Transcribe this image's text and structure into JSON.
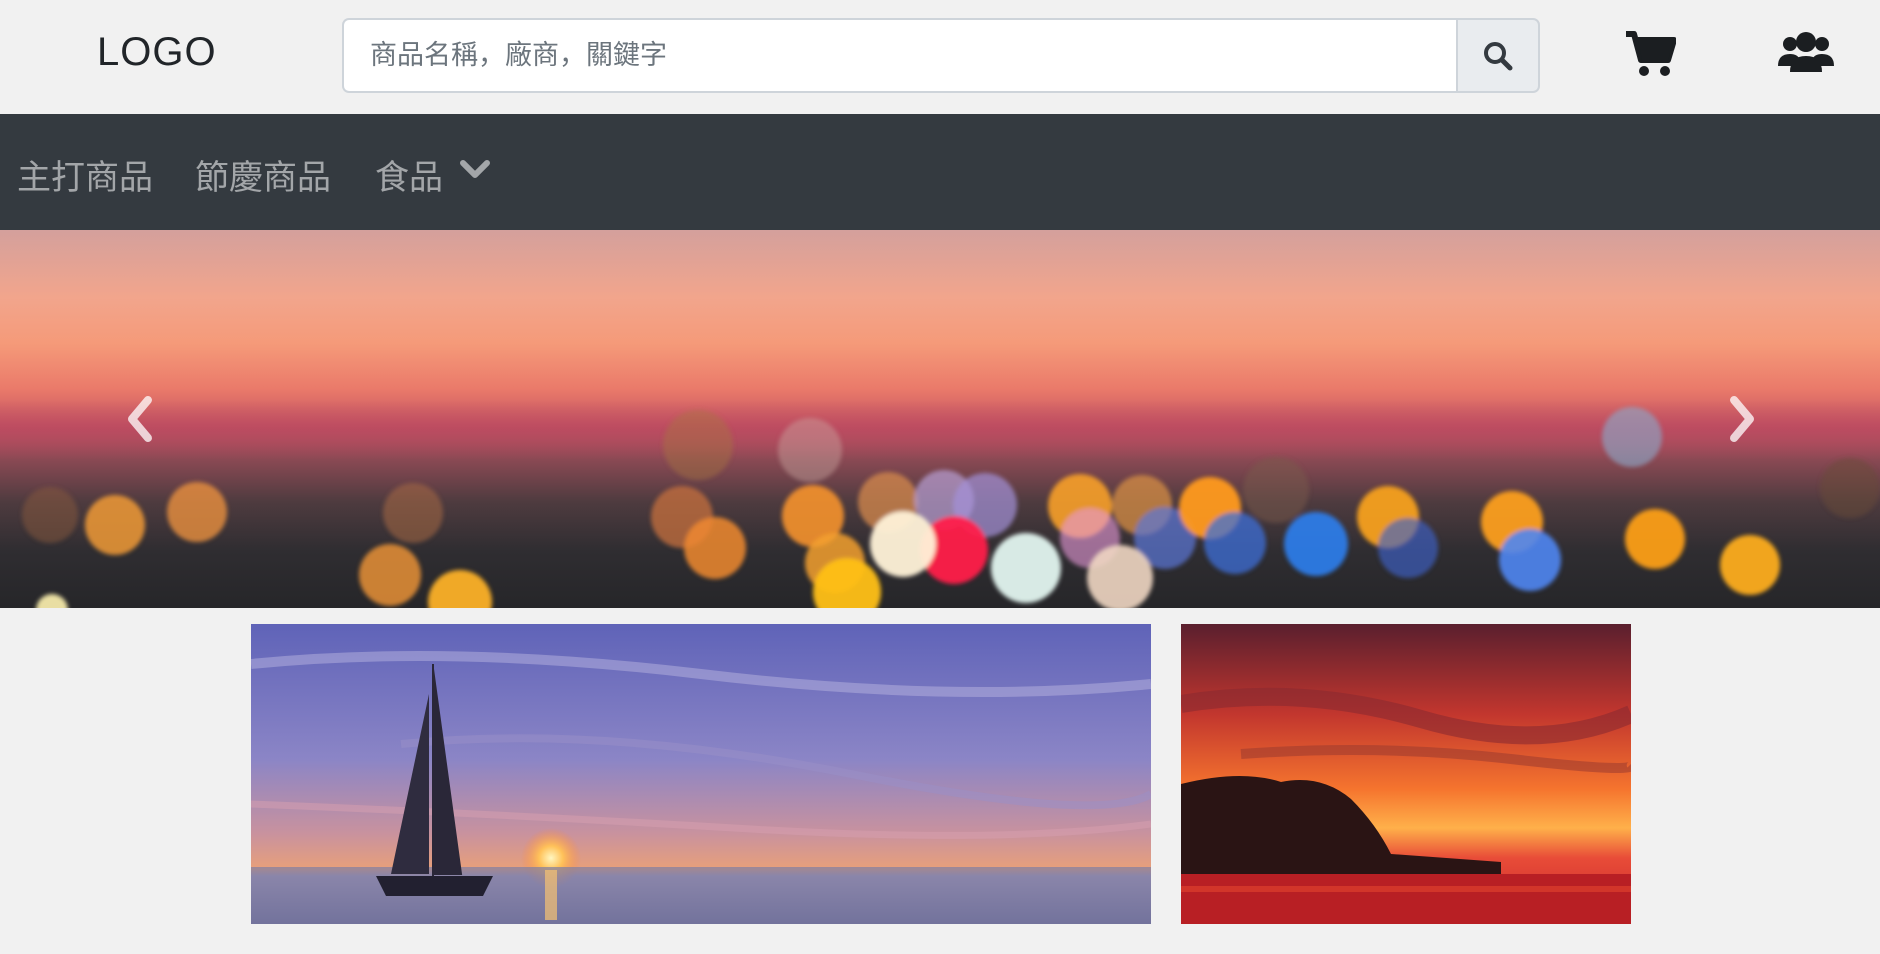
{
  "header": {
    "logo": "LOGO",
    "search": {
      "placeholder": "商品名稱，廠商，關鍵字",
      "value": ""
    },
    "icons": {
      "search": "search-icon",
      "cart": "cart-icon",
      "members": "users-icon"
    }
  },
  "nav": {
    "items": [
      {
        "label": "主打商品"
      },
      {
        "label": "節慶商品"
      },
      {
        "label": "食品",
        "dropdown": true,
        "icon": "chevron-down-icon"
      }
    ]
  },
  "carousel": {
    "slide": "sunset-bokeh",
    "controls": {
      "prev": "chevron-left-icon",
      "next": "chevron-right-icon"
    }
  },
  "thumbnails": [
    {
      "image": "sailboat-sunset"
    },
    {
      "image": "red-sunset-headland"
    }
  ],
  "colors": {
    "navbar": "#343a40",
    "page_bg": "#f1f1f1",
    "nav_text": "rgba(255,255,255,0.55)",
    "icon": "#212529"
  }
}
